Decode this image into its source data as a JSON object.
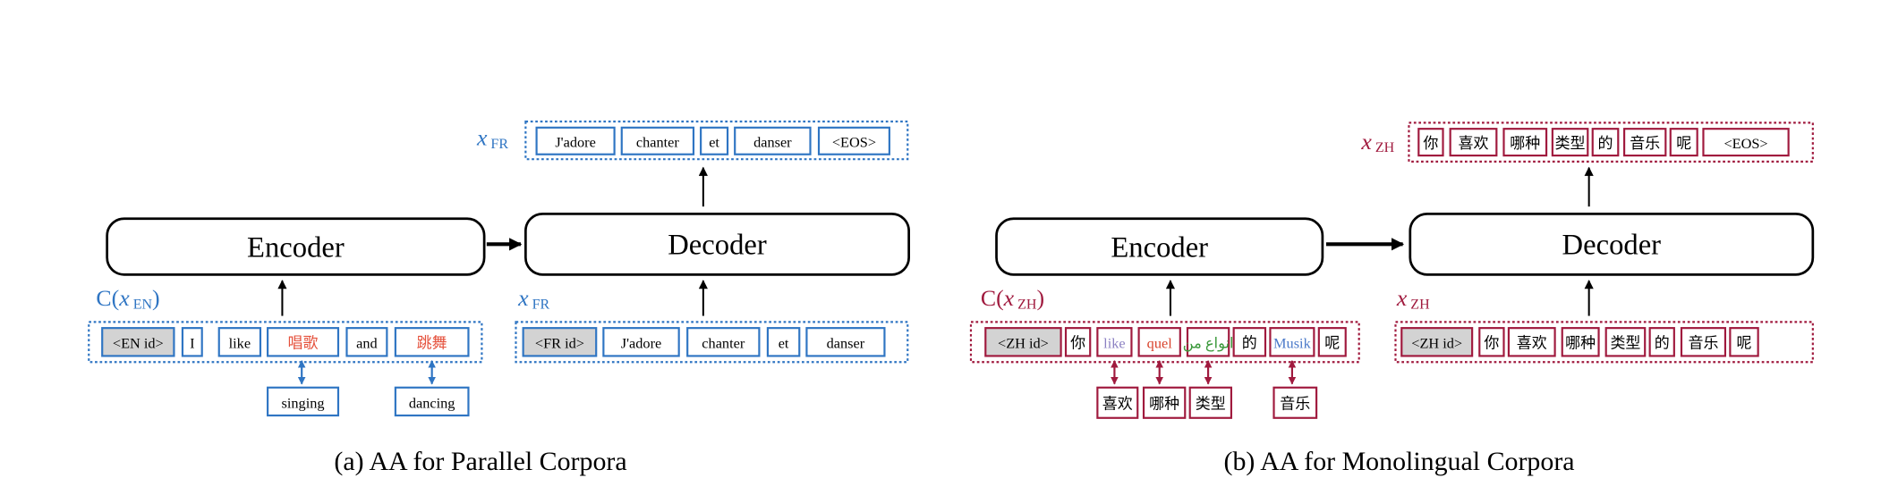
{
  "colors": {
    "blue": "#2f75c3",
    "maroon": "#a01a3e",
    "red_text": "#e5513c",
    "token_gray_fill": "#d3d3d3",
    "like_purple": "#8b80c2",
    "quel_red": "#d8422b",
    "arabic_green": "#3d9a3d",
    "musik_blue": "#4b79c9"
  },
  "panel_a": {
    "encoder_label": "Encoder",
    "decoder_label": "Decoder",
    "output_label": "x_FR",
    "input_label": "C(x_EN)",
    "decoder_input_label": "x_FR",
    "output_tokens": [
      "J'adore",
      "chanter",
      "et",
      "danser",
      "<EOS>"
    ],
    "encoder_tokens": [
      "<EN id>",
      "I",
      "like",
      "唱歌",
      "and",
      "跳舞"
    ],
    "aligned_words": [
      "singing",
      "dancing"
    ],
    "decoder_tokens": [
      "<FR id>",
      "J'adore",
      "chanter",
      "et",
      "danser"
    ],
    "caption": "(a) AA for Parallel Corpora"
  },
  "panel_b": {
    "encoder_label": "Encoder",
    "decoder_label": "Decoder",
    "output_label": "x_ZH",
    "input_label": "C(x_ZH)",
    "decoder_input_label": "x_ZH",
    "output_tokens": [
      "你",
      "喜欢",
      "哪种",
      "类型",
      "的",
      "音乐",
      "呢",
      "<EOS>"
    ],
    "encoder_tokens": [
      "<ZH id>",
      "你",
      "like",
      "quel",
      "انواع من",
      "的",
      "Musik",
      "呢"
    ],
    "aligned_words": [
      "喜欢",
      "哪种",
      "类型",
      "音乐"
    ],
    "decoder_tokens": [
      "<ZH id>",
      "你",
      "喜欢",
      "哪种",
      "类型",
      "的",
      "音乐",
      "呢"
    ],
    "caption": "(b) AA for Monolingual Corpora"
  }
}
